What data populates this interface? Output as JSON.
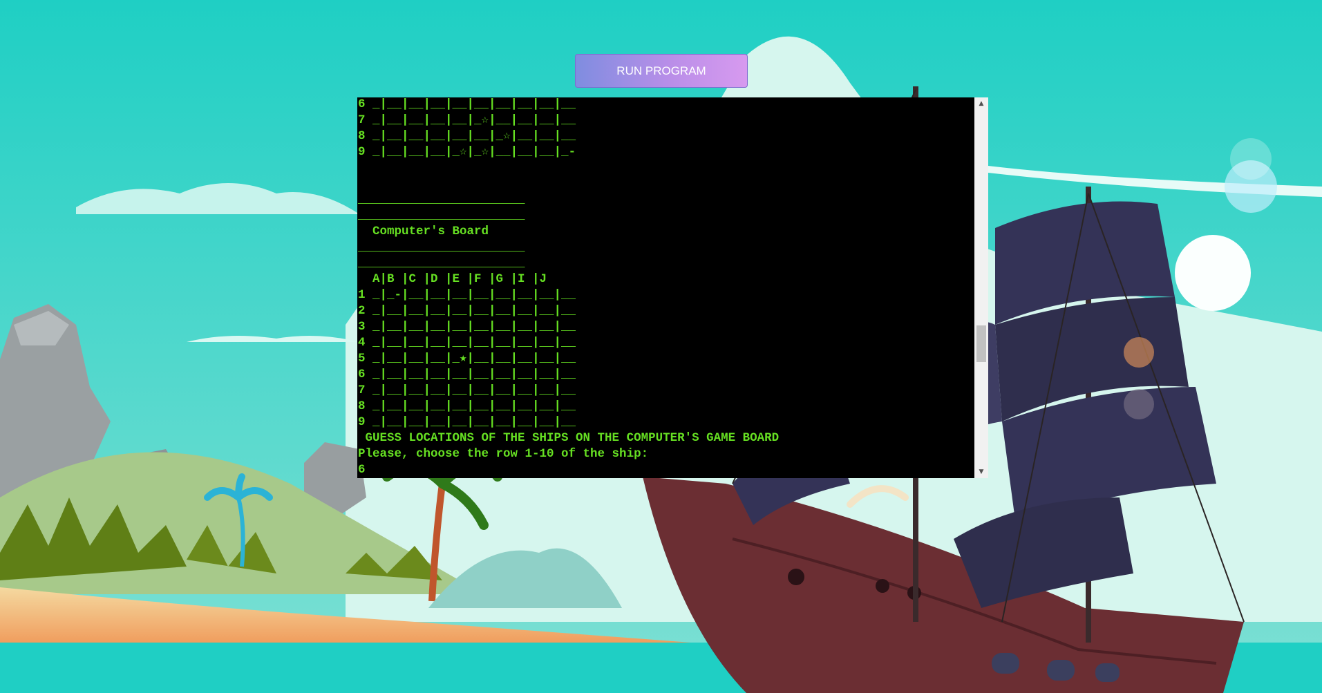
{
  "toolbar": {
    "run_label": "RUN PROGRAM"
  },
  "terminal": {
    "lines": [
      "6 _|__|__|__|__|__|__|__|__|__",
      "7 _|__|__|__|__|_☆|__|__|__|__",
      "8 _|__|__|__|__|__|_☆|__|__|__",
      "9 _|__|__|__|_☆|_☆|__|__|__|_-",
      "",
      "",
      "_______________________",
      "_______________________",
      "  Computer's Board",
      "_______________________",
      "_______________________",
      "  A|B |C |D |E |F |G |I |J",
      "1 _|_-|__|__|__|__|__|__|__|__",
      "2 _|__|__|__|__|__|__|__|__|__",
      "3 _|__|__|__|__|__|__|__|__|__",
      "4 _|__|__|__|__|__|__|__|__|__",
      "5 _|__|__|__|_★|__|__|__|__|__",
      "6 _|__|__|__|__|__|__|__|__|__",
      "7 _|__|__|__|__|__|__|__|__|__",
      "8 _|__|__|__|__|__|__|__|__|__",
      "9 _|__|__|__|__|__|__|__|__|__",
      " GUESS LOCATIONS OF THE SHIPS ON THE COMPUTER'S GAME BOARD",
      "Please, choose the row 1-10 of the ship:",
      "6"
    ]
  },
  "scrollbar": {
    "up_icon": "▲",
    "down_icon": "▼"
  },
  "colors": {
    "terminal_text": "#66e022",
    "terminal_bg": "#000000",
    "button_start": "#7f8de0",
    "button_end": "#d79aef"
  }
}
